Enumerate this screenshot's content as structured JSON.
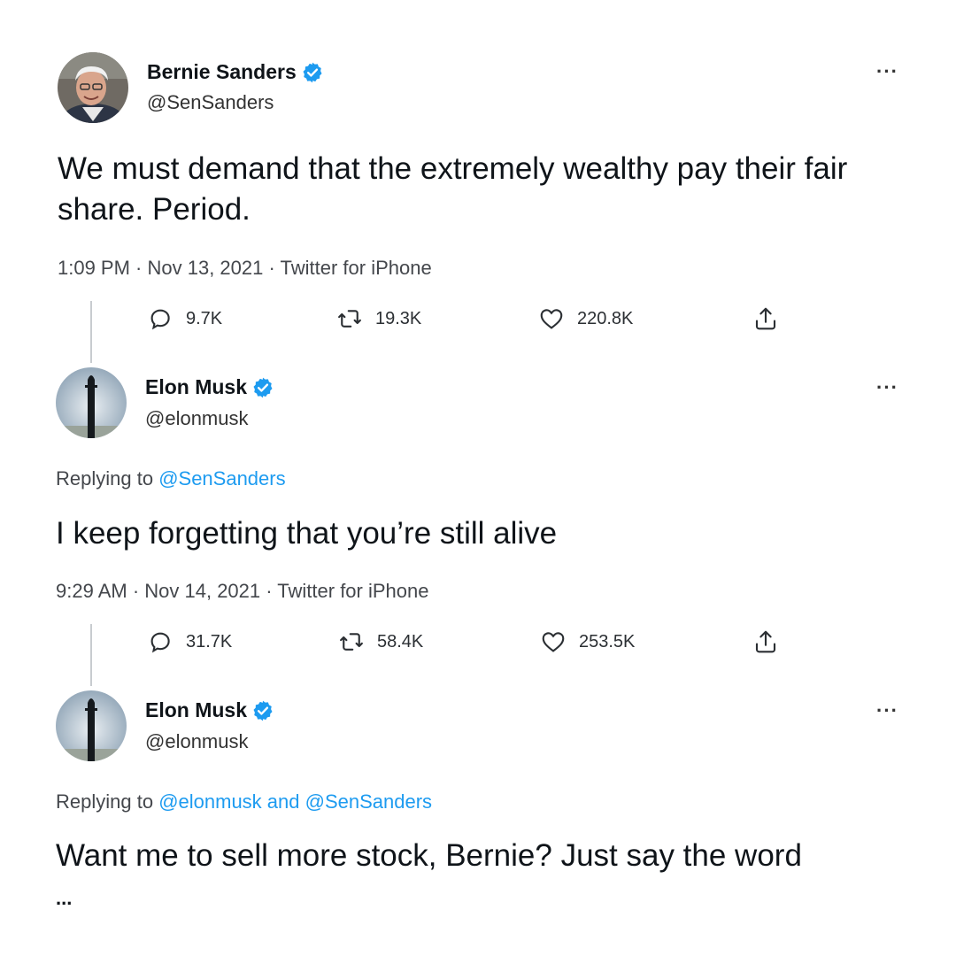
{
  "tweets": [
    {
      "name": "Bernie Sanders",
      "handle": "@SenSanders",
      "text": "We must demand that the extremely wealthy pay their fair share. Period.",
      "timestamp": "1:09 PM · Nov 13, 2021 · Twitter for iPhone",
      "replies": "9.7K",
      "retweets": "19.3K",
      "likes": "220.8K"
    },
    {
      "name": "Elon Musk",
      "handle": "@elonmusk",
      "replying_prefix": "Replying to ",
      "replying_to": [
        "@SenSanders"
      ],
      "text": "I keep forgetting that you’re still alive",
      "timestamp": "9:29 AM · Nov 14, 2021 · Twitter for iPhone",
      "replies": "31.7K",
      "retweets": "58.4K",
      "likes": "253.5K"
    },
    {
      "name": "Elon Musk",
      "handle": "@elonmusk",
      "replying_prefix": "Replying to ",
      "replying_to": [
        "@elonmusk",
        "@SenSanders"
      ],
      "replying_join": " and ",
      "text": "Want me to sell more stock, Bernie? Just say the word",
      "trailing": "..."
    }
  ],
  "more_label": "···",
  "icons": {
    "verified": "verified-badge-icon",
    "reply": "reply-bubble-icon",
    "retweet": "retweet-icon",
    "like": "heart-icon",
    "share": "share-icon"
  },
  "colors": {
    "accent": "#1d9bf0",
    "text": "#0f1419",
    "muted": "#536471"
  }
}
